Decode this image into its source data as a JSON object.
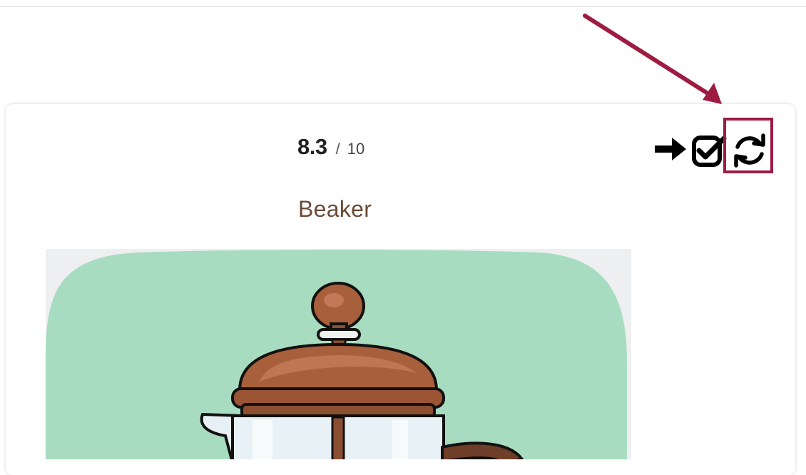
{
  "card": {
    "score": {
      "value": "8.3",
      "separator": "/",
      "max": "10"
    },
    "title": "Beaker",
    "actions": [
      {
        "icon": "arrow-right-icon"
      },
      {
        "icon": "checkbox-checked-icon"
      },
      {
        "icon": "refresh-icon"
      }
    ],
    "image": {
      "subject": "french-press-icon"
    }
  },
  "colors": {
    "annotation": "#9e1b42",
    "title": "#6b4a38",
    "image_background": "#eeeff1",
    "blob": "#a8dcc0",
    "copper": "#a85f3b"
  }
}
